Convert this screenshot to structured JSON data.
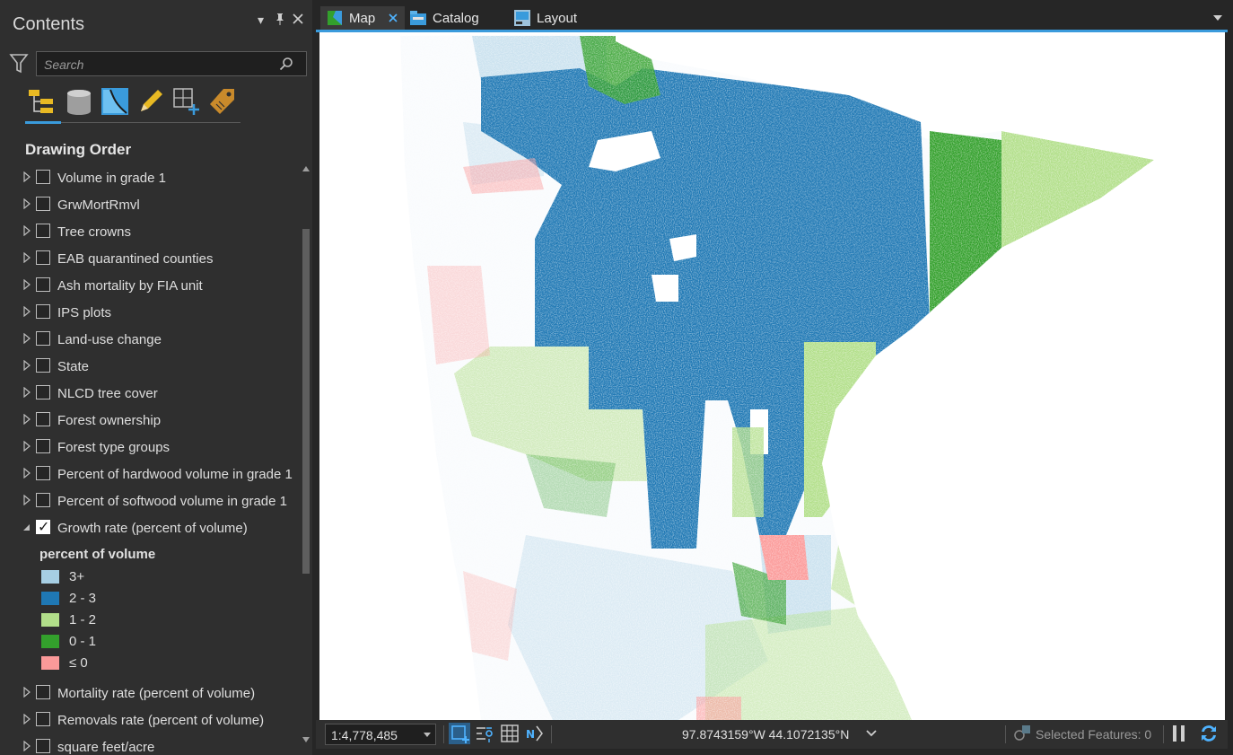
{
  "contents": {
    "title": "Contents",
    "search_placeholder": "Search",
    "drawing_order": "Drawing Order",
    "tools": [
      "list-by-drawing-order-icon",
      "list-by-data-source-icon",
      "list-by-selection-icon",
      "list-by-editing-icon",
      "list-by-snapping-icon",
      "list-by-labeling-icon"
    ]
  },
  "layers": [
    {
      "label": "Volume in grade 1",
      "checked": false
    },
    {
      "label": "GrwMortRmvl",
      "checked": false
    },
    {
      "label": "Tree crowns",
      "checked": false
    },
    {
      "label": "EAB quarantined counties",
      "checked": false
    },
    {
      "label": "Ash mortality by FIA unit",
      "checked": false
    },
    {
      "label": "IPS plots",
      "checked": false
    },
    {
      "label": "Land-use change",
      "checked": false
    },
    {
      "label": "State",
      "checked": false
    },
    {
      "label": "NLCD tree cover",
      "checked": false
    },
    {
      "label": "Forest ownership",
      "checked": false
    },
    {
      "label": "Forest type groups",
      "checked": false
    },
    {
      "label": "Percent of hardwood volume in grade 1",
      "checked": false
    },
    {
      "label": "Percent of softwood volume in grade 1",
      "checked": false
    },
    {
      "label": "Growth rate (percent of volume)",
      "checked": true,
      "expanded": true
    }
  ],
  "legend": {
    "heading": "percent of volume",
    "items": [
      {
        "label": "3+",
        "color": "#a6cee3"
      },
      {
        "label": "2 - 3",
        "color": "#1f78b4"
      },
      {
        "label": "1 - 2",
        "color": "#b2df8a"
      },
      {
        "label": "0 - 1",
        "color": "#33a02c"
      },
      {
        "label": "≤ 0",
        "color": "#fb9a99"
      }
    ]
  },
  "layers_after": [
    {
      "label": "Mortality rate (percent of volume)",
      "checked": false
    },
    {
      "label": "Removals rate (percent of volume)",
      "checked": false
    },
    {
      "label": "square feet/acre",
      "checked": false
    }
  ],
  "tabs": [
    {
      "label": "Map",
      "active": true
    },
    {
      "label": "Catalog",
      "active": false
    },
    {
      "label": "Layout",
      "active": false
    }
  ],
  "status": {
    "scale": "1:4,778,485",
    "coordinates": "97.8743159°W 44.1072135°N",
    "selected_features": "Selected Features: 0"
  },
  "colors": {
    "accent": "#3a9bdc",
    "class_3plus": "#a6cee3",
    "class_2_3": "#1f78b4",
    "class_1_2": "#b2df8a",
    "class_0_1": "#33a02c",
    "class_le0": "#fb9a99"
  }
}
